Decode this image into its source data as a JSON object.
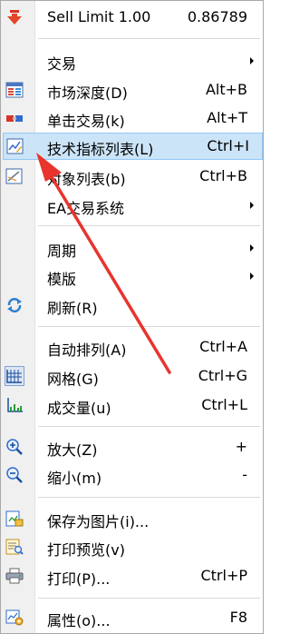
{
  "menu": {
    "items": [
      {
        "label": "Sell Limit 1.00",
        "shortcut": "0.86789",
        "icon": "sell-arrow-icon"
      },
      {
        "label": "交易",
        "submenu": true
      },
      {
        "label": "市场深度(D)",
        "shortcut": "Alt+B",
        "icon": "market-depth-icon"
      },
      {
        "label": "单击交易(k)",
        "shortcut": "Alt+T",
        "icon": "one-click-trade-icon"
      },
      {
        "label": "技术指标列表(L)",
        "shortcut": "Ctrl+I",
        "icon": "indicator-list-icon",
        "selected": true
      },
      {
        "label": "对象列表(b)",
        "shortcut": "Ctrl+B",
        "icon": "object-list-icon"
      },
      {
        "label": "EA交易系统",
        "submenu": true
      },
      {
        "label": "周期",
        "submenu": true
      },
      {
        "label": "模版",
        "submenu": true
      },
      {
        "label": "刷新(R)",
        "icon": "refresh-icon"
      },
      {
        "label": "自动排列(A)",
        "shortcut": "Ctrl+A"
      },
      {
        "label": "网格(G)",
        "shortcut": "Ctrl+G",
        "icon": "grid-icon"
      },
      {
        "label": "成交量(u)",
        "shortcut": "Ctrl+L",
        "icon": "volume-icon"
      },
      {
        "label": "放大(Z)",
        "shortcut": "+",
        "icon": "zoom-in-icon"
      },
      {
        "label": "缩小(m)",
        "shortcut": "-",
        "icon": "zoom-out-icon"
      },
      {
        "label": "保存为图片(i)...",
        "icon": "save-image-icon"
      },
      {
        "label": "打印预览(v)",
        "icon": "print-preview-icon"
      },
      {
        "label": "打印(P)...",
        "shortcut": "Ctrl+P",
        "icon": "print-icon"
      },
      {
        "label": "属性(o)...",
        "shortcut": "F8",
        "icon": "properties-icon"
      }
    ]
  },
  "colors": {
    "selection": "#cce4f7",
    "selection_border": "#90c8f6",
    "annotation_arrow": "#e8342d"
  }
}
